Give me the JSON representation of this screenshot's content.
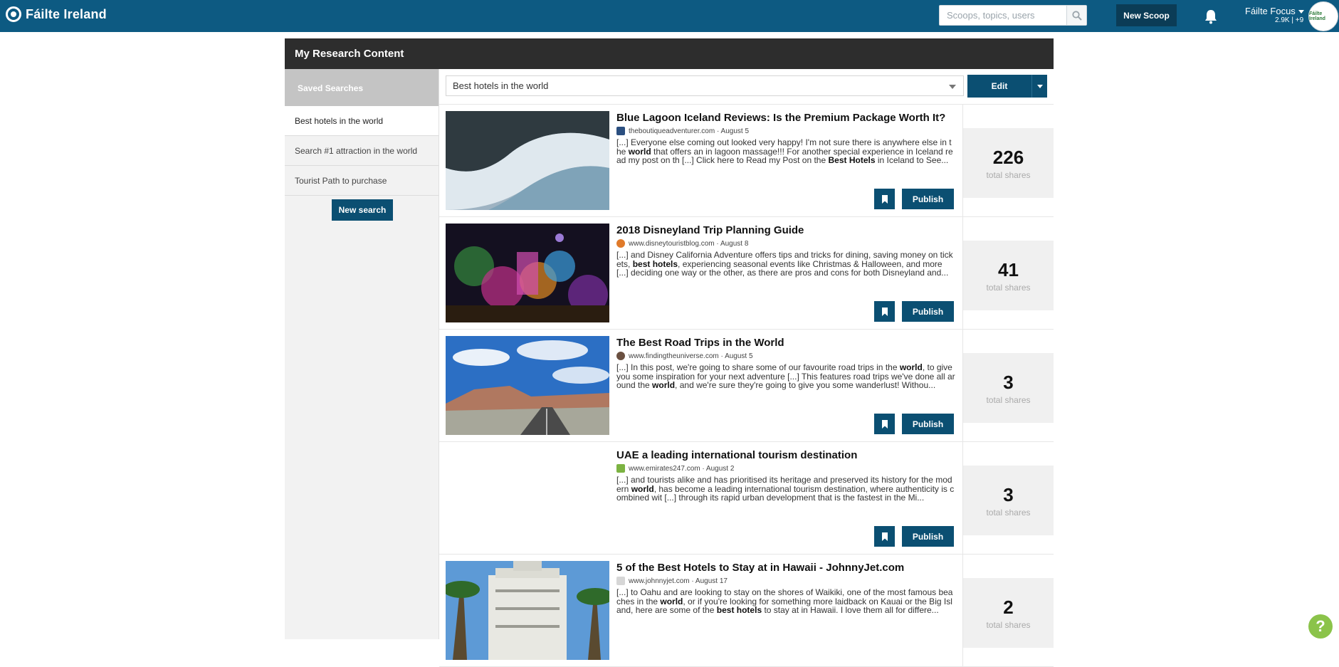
{
  "topbar": {
    "brand": "Fáilte Ireland",
    "search_placeholder": "Scoops, topics, users",
    "new_scoop_label": "New Scoop",
    "user_name": "Fáilte Focus",
    "user_stats": "2.9K | +9",
    "avatar_text": "Fáilte Ireland"
  },
  "panel": {
    "title": "My Research Content"
  },
  "sidebar": {
    "title": "Saved Searches",
    "items": [
      {
        "label": "Best hotels in the world",
        "active": true
      },
      {
        "label": "Search #1 attraction in the world",
        "active": false
      },
      {
        "label": "Tourist Path to purchase",
        "active": false
      }
    ],
    "new_search_label": "New search"
  },
  "filter": {
    "selected": "Best hotels in the world",
    "edit_label": "Edit"
  },
  "results": [
    {
      "title": "Blue Lagoon Iceland Reviews: Is the Premium Package Worth It?",
      "source": "theboutiqueadventurer.com · August 5",
      "excerpt_html": "[...] Everyone else coming out looked very happy! I'm not sure there is anywhere else in the <b>world</b> that offers an in lagoon massage!!! For another special experience in Iceland read my post on th [...] Click here to Read my Post on the <b>Best Hotels</b> in Iceland to See...",
      "shares": "226",
      "shares_label": "total shares",
      "publish_label": "Publish"
    },
    {
      "title": "2018 Disneyland Trip Planning Guide",
      "source": "www.disneytouristblog.com · August 8",
      "excerpt_html": "[...] and Disney California Adventure offers tips and tricks for dining, saving money on tickets, <b>best hotels</b>, experiencing seasonal events like Christmas &amp; Halloween, and more [...] deciding one way or the other, as there are pros and cons for both Disneyland and...",
      "shares": "41",
      "shares_label": "total shares",
      "publish_label": "Publish"
    },
    {
      "title": "The Best Road Trips in the World",
      "source": "www.findingtheuniverse.com · August 5",
      "excerpt_html": "[...] In this post, we're going to share some of our favourite road trips in the <b>world</b>, to give you some inspiration for your next adventure [...] This features road trips we've done all around the <b>world</b>, and we're sure they're going to give you some wanderlust! Withou...",
      "shares": "3",
      "shares_label": "total shares",
      "publish_label": "Publish"
    },
    {
      "title": "UAE a leading international tourism destination",
      "source": "www.emirates247.com · August 2",
      "excerpt_html": "[...] and tourists alike and has prioritised its heritage and preserved its history for the modern <b>world</b>, has become a leading international tourism destination, where authenticity is combined wit [...] through its rapid urban development that is the fastest in the Mi...",
      "shares": "3",
      "shares_label": "total shares",
      "publish_label": "Publish"
    },
    {
      "title": "5 of the Best Hotels to Stay at in Hawaii - JohnnyJet.com",
      "source": "www.johnnyjet.com · August 17",
      "excerpt_html": "[...] to Oahu and are looking to stay on the shores of Waikiki, one of the most famous beaches in the <b>world</b>, or if you're looking for something more laidback on Kauai or the Big Island, here are some of the <b>best hotels</b> to stay at in Hawaii. I love them all for differe...",
      "shares": "2",
      "shares_label": "total shares",
      "publish_label": "Publish"
    }
  ],
  "help_label": "?",
  "colors": {
    "topbar": "#0d5a82",
    "button": "#0b4f72",
    "panel_header": "#2d2d2d",
    "help": "#8bc34a"
  }
}
